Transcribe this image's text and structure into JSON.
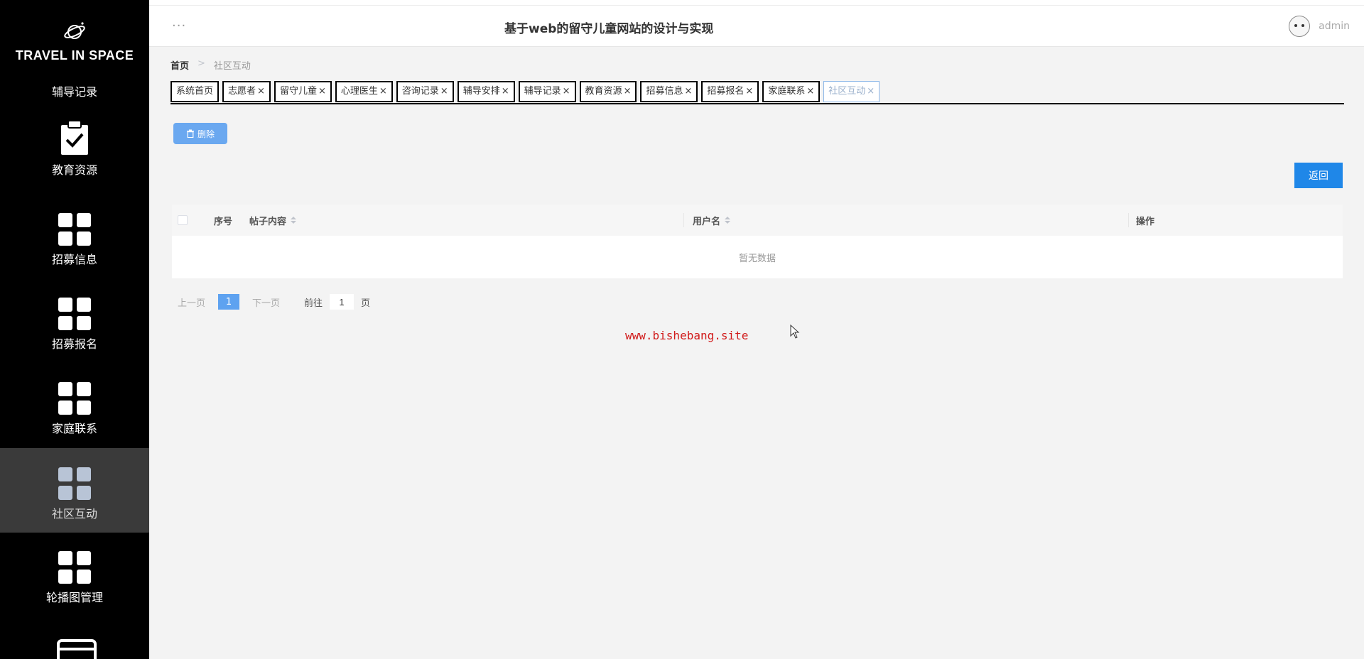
{
  "sidebar": {
    "brand": "TRAVEL IN SPACE",
    "items": [
      {
        "label": "辅导记录",
        "icon": "list-icon"
      },
      {
        "label": "教育资源",
        "icon": "clipboard-check-icon"
      },
      {
        "label": "招募信息",
        "icon": "grid-icon"
      },
      {
        "label": "招募报名",
        "icon": "grid-icon"
      },
      {
        "label": "家庭联系",
        "icon": "grid-icon"
      },
      {
        "label": "社区互动",
        "icon": "grid-icon",
        "active": true
      },
      {
        "label": "轮播图管理",
        "icon": "grid-icon"
      }
    ]
  },
  "header": {
    "menu_dots": "···",
    "title": "基于web的留守儿童网站的设计与实现",
    "user": "admin"
  },
  "breadcrumb": {
    "home": "首页",
    "separator": ">",
    "current": "社区互动"
  },
  "tabs": [
    {
      "label": "系统首页",
      "closable": false
    },
    {
      "label": "志愿者",
      "closable": true
    },
    {
      "label": "留守儿童",
      "closable": true
    },
    {
      "label": "心理医生",
      "closable": true
    },
    {
      "label": "咨询记录",
      "closable": true
    },
    {
      "label": "辅导安排",
      "closable": true
    },
    {
      "label": "辅导记录",
      "closable": true
    },
    {
      "label": "教育资源",
      "closable": true
    },
    {
      "label": "招募信息",
      "closable": true
    },
    {
      "label": "招募报名",
      "closable": true
    },
    {
      "label": "家庭联系",
      "closable": true
    },
    {
      "label": "社区互动",
      "closable": true,
      "active": true
    }
  ],
  "close_glyph": "×",
  "toolbar": {
    "delete_label": "删除",
    "back_label": "返回"
  },
  "table": {
    "columns": {
      "index": "序号",
      "content": "帖子内容",
      "username": "用户名",
      "actions": "操作"
    },
    "empty_text": "暂无数据"
  },
  "pagination": {
    "prev": "上一页",
    "current_page": "1",
    "next": "下一页",
    "goto": "前往",
    "goto_value": "1",
    "unit": "页"
  },
  "watermark": "www.bishebang.site",
  "colors": {
    "sidebar_bg": "#000000",
    "active_item_bg": "#3a3a3a",
    "primary_button": "#1f87e8",
    "delete_button": "#6aa8f0",
    "watermark": "#d11a1a"
  }
}
